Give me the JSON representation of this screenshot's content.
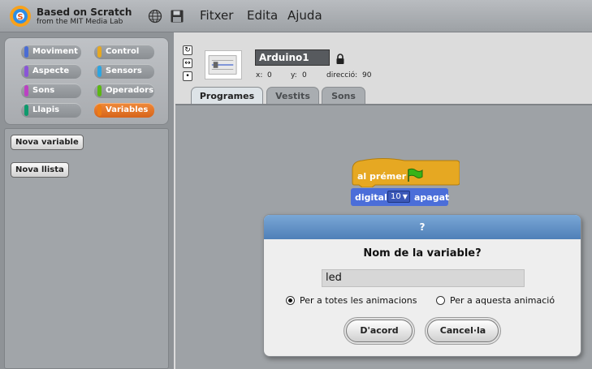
{
  "app": {
    "title": "Based on Scratch",
    "subtitle": "from the MIT Media Lab"
  },
  "icons": {
    "logo": "scratch-logo-icon",
    "language": "globe-icon",
    "save": "floppy-disk-icon",
    "lock": "lock-icon",
    "flag": "green-flag-icon"
  },
  "menu": [
    "Fitxer",
    "Edita",
    "Ajuda"
  ],
  "categories": {
    "items": [
      {
        "label": "Moviment",
        "color": "#4a6cd4"
      },
      {
        "label": "Control",
        "color": "#e6a822"
      },
      {
        "label": "Aspecte",
        "color": "#8a55d7"
      },
      {
        "label": "Sensors",
        "color": "#2ca5e2"
      },
      {
        "label": "Sons",
        "color": "#bb42c3"
      },
      {
        "label": "Operadors",
        "color": "#5cb712"
      },
      {
        "label": "Llapis",
        "color": "#0e9a6c"
      },
      {
        "label": "Variables",
        "color": "#ee7d16"
      }
    ],
    "selected": "Variables"
  },
  "palette": {
    "new_variable": "Nova variable",
    "new_list": "Nova llista"
  },
  "sprite": {
    "name": "Arduino1",
    "x_label": "x:",
    "x_value": "0",
    "y_label": "y:",
    "y_value": "0",
    "direction_label": "direcció:",
    "direction_value": "90"
  },
  "tabs": [
    {
      "label": "Programes",
      "selected": true
    },
    {
      "label": "Vestits",
      "selected": false
    },
    {
      "label": "Sons",
      "selected": false
    }
  ],
  "script": {
    "hat_label": "al prémer",
    "command_label": "digital",
    "command_value": "10",
    "command_suffix": "apagat",
    "hat_color": "#e6a822",
    "command_color": "#4b6ed9"
  },
  "dialog": {
    "title": "?",
    "question": "Nom de la variable?",
    "input_value": "led",
    "option_all": "Per a totes les animacions",
    "option_this": "Per a aquesta animació",
    "selected_option": "all",
    "ok": "D'acord",
    "cancel": "Cancel·la"
  }
}
